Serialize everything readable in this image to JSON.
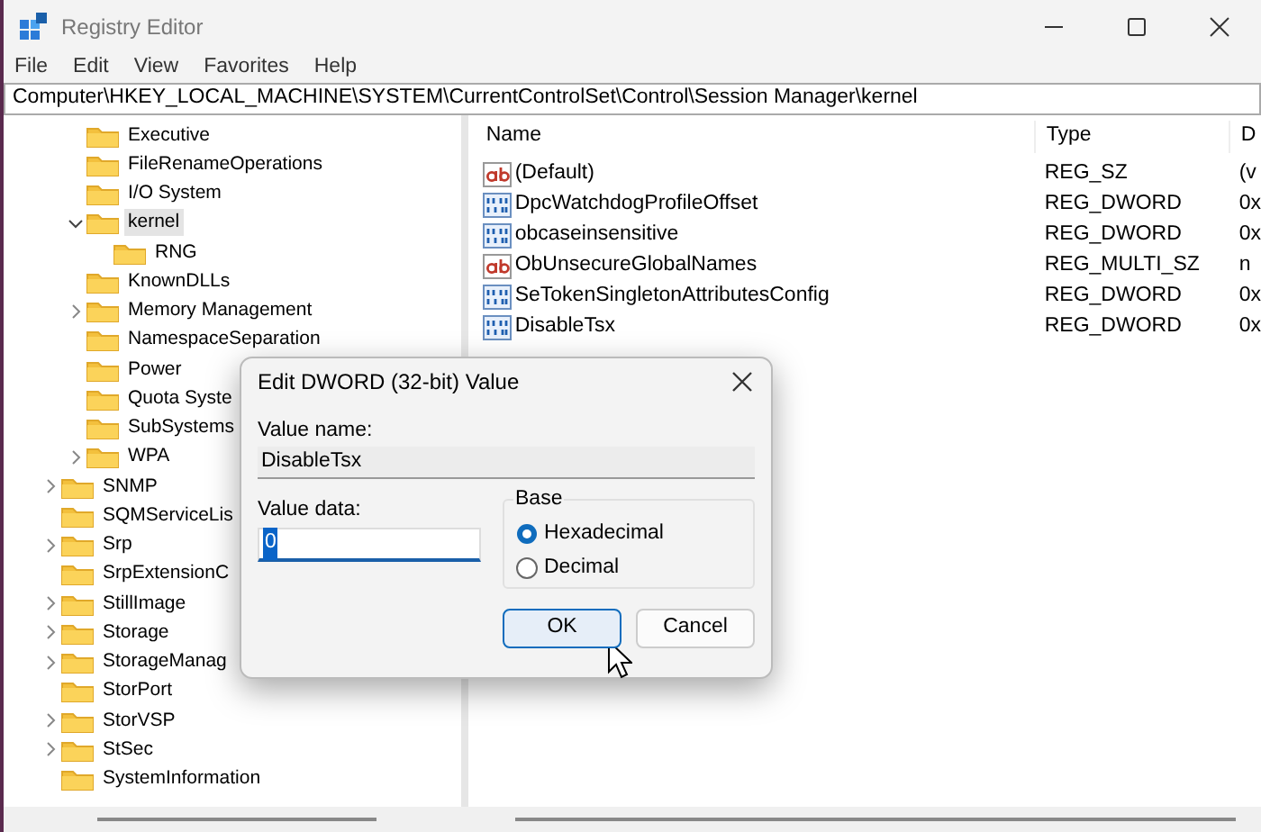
{
  "window": {
    "title": "Registry Editor"
  },
  "menu": [
    "File",
    "Edit",
    "View",
    "Favorites",
    "Help"
  ],
  "address": "Computer\\HKEY_LOCAL_MACHINE\\SYSTEM\\CurrentControlSet\\Control\\Session Manager\\kernel",
  "tree": {
    "nested": [
      {
        "label": "Executive",
        "expandable": false,
        "selected": false
      },
      {
        "label": "FileRenameOperations",
        "expandable": false,
        "selected": false
      },
      {
        "label": "I/O System",
        "expandable": false,
        "selected": false
      },
      {
        "label": "kernel",
        "expandable": true,
        "expanded": true,
        "selected": true,
        "children": [
          {
            "label": "RNG",
            "expandable": false,
            "selected": false
          }
        ]
      },
      {
        "label": "KnownDLLs",
        "expandable": false,
        "selected": false
      },
      {
        "label": "Memory Management",
        "expandable": true,
        "expanded": false,
        "selected": false
      },
      {
        "label": "NamespaceSeparation",
        "expandable": false,
        "selected": false
      },
      {
        "label": "Power",
        "expandable": false,
        "selected": false
      },
      {
        "label": "Quota Syste",
        "expandable": false,
        "selected": false
      },
      {
        "label": "SubSystems",
        "expandable": false,
        "selected": false
      },
      {
        "label": "WPA",
        "expandable": true,
        "expanded": false,
        "selected": false
      }
    ],
    "items": [
      {
        "label": "SNMP",
        "expandable": true,
        "expanded": false,
        "selected": false
      },
      {
        "label": "SQMServiceLis",
        "expandable": false,
        "selected": false
      },
      {
        "label": "Srp",
        "expandable": true,
        "expanded": false,
        "selected": false
      },
      {
        "label": "SrpExtensionC",
        "expandable": false,
        "selected": false
      },
      {
        "label": "StillImage",
        "expandable": true,
        "expanded": false,
        "selected": false
      },
      {
        "label": "Storage",
        "expandable": true,
        "expanded": false,
        "selected": false
      },
      {
        "label": "StorageManag",
        "expandable": true,
        "expanded": false,
        "selected": false
      },
      {
        "label": "StorPort",
        "expandable": false,
        "selected": false
      },
      {
        "label": "StorVSP",
        "expandable": true,
        "expanded": false,
        "selected": false
      },
      {
        "label": "StSec",
        "expandable": true,
        "expanded": false,
        "selected": false
      },
      {
        "label": "SystemInformation",
        "expandable": false,
        "selected": false
      }
    ]
  },
  "values": {
    "columns": [
      "Name",
      "Type",
      "D"
    ],
    "rows": [
      {
        "kind": "string",
        "name": "(Default)",
        "type": "REG_SZ",
        "data": "(v"
      },
      {
        "kind": "binary",
        "name": "DpcWatchdogProfileOffset",
        "type": "REG_DWORD",
        "data": "0x"
      },
      {
        "kind": "binary",
        "name": "obcaseinsensitive",
        "type": "REG_DWORD",
        "data": "0x"
      },
      {
        "kind": "string",
        "name": "ObUnsecureGlobalNames",
        "type": "REG_MULTI_SZ",
        "data": "n"
      },
      {
        "kind": "binary",
        "name": "SeTokenSingletonAttributesConfig",
        "type": "REG_DWORD",
        "data": "0x"
      },
      {
        "kind": "binary",
        "name": "DisableTsx",
        "type": "REG_DWORD",
        "data": "0x"
      }
    ]
  },
  "dialog": {
    "title": "Edit DWORD (32-bit) Value",
    "value_name_label": "Value name:",
    "value_name": "DisableTsx",
    "value_data_label": "Value data:",
    "value_data": "0",
    "base_label": "Base",
    "base_options": [
      {
        "label": "Hexadecimal",
        "selected": true
      },
      {
        "label": "Decimal",
        "selected": false
      }
    ],
    "buttons": [
      {
        "label": "OK",
        "default": true
      },
      {
        "label": "Cancel",
        "default": false
      }
    ]
  }
}
